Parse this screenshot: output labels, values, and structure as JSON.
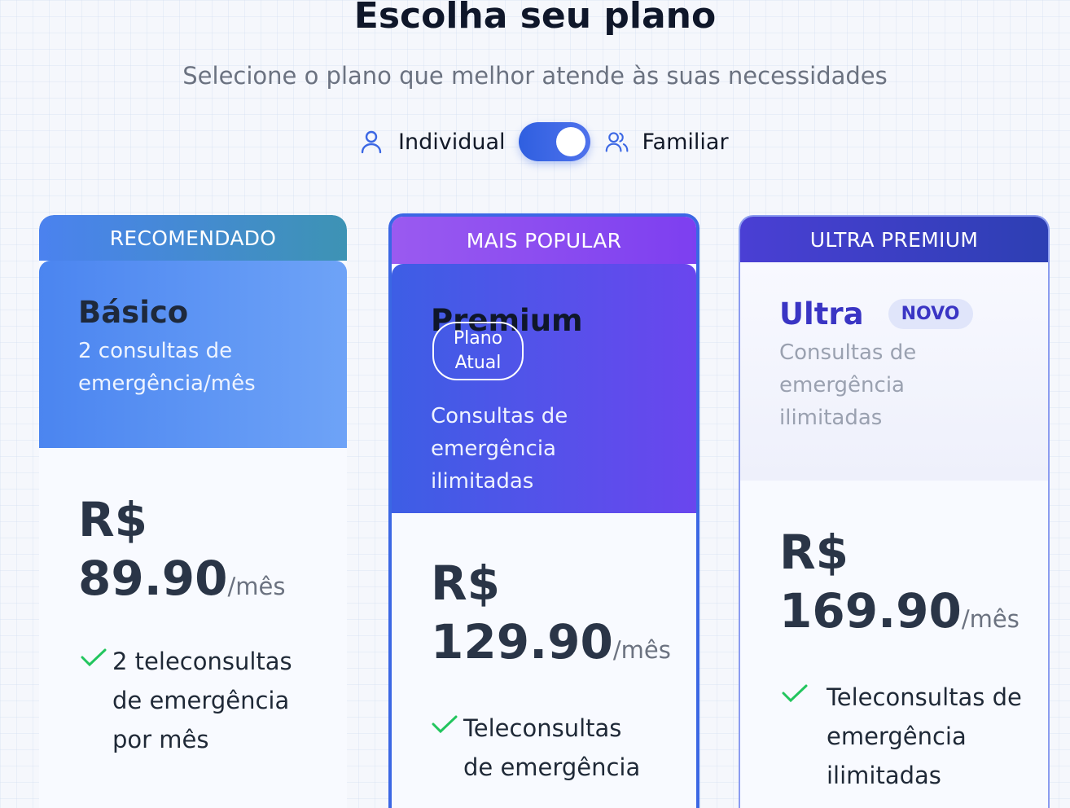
{
  "header": {
    "title": "Escolha seu plano",
    "subtitle": "Selecione o plano que melhor atende às suas necessidades"
  },
  "toggle": {
    "left_label": "Individual",
    "right_label": "Familiar",
    "selected": "Familiar"
  },
  "colors": {
    "accent": "#3b67e4",
    "check": "#22c55e"
  },
  "plans": [
    {
      "banner": "RECOMENDADO",
      "name": "Básico",
      "description": "2 consultas de emergência/mês",
      "price_prefix": "R$",
      "price": "89.90",
      "period": "/mês",
      "features": [
        "2 teleconsultas de emergência por mês"
      ]
    },
    {
      "banner": "MAIS POPULAR",
      "name": "Premium",
      "badge": "Plano Atual",
      "description": "Consultas de emergência ilimitadas",
      "price_prefix": "R$",
      "price": "129.90",
      "period": "/mês",
      "features": [
        "Teleconsultas de emergência"
      ]
    },
    {
      "banner": "ULTRA PREMIUM",
      "name": "Ultra",
      "badge": "NOVO",
      "description": "Consultas de emergência ilimitadas",
      "price_prefix": "R$",
      "price": "169.90",
      "period": "/mês",
      "features": [
        "Teleconsultas de emergência ilimitadas"
      ]
    }
  ]
}
